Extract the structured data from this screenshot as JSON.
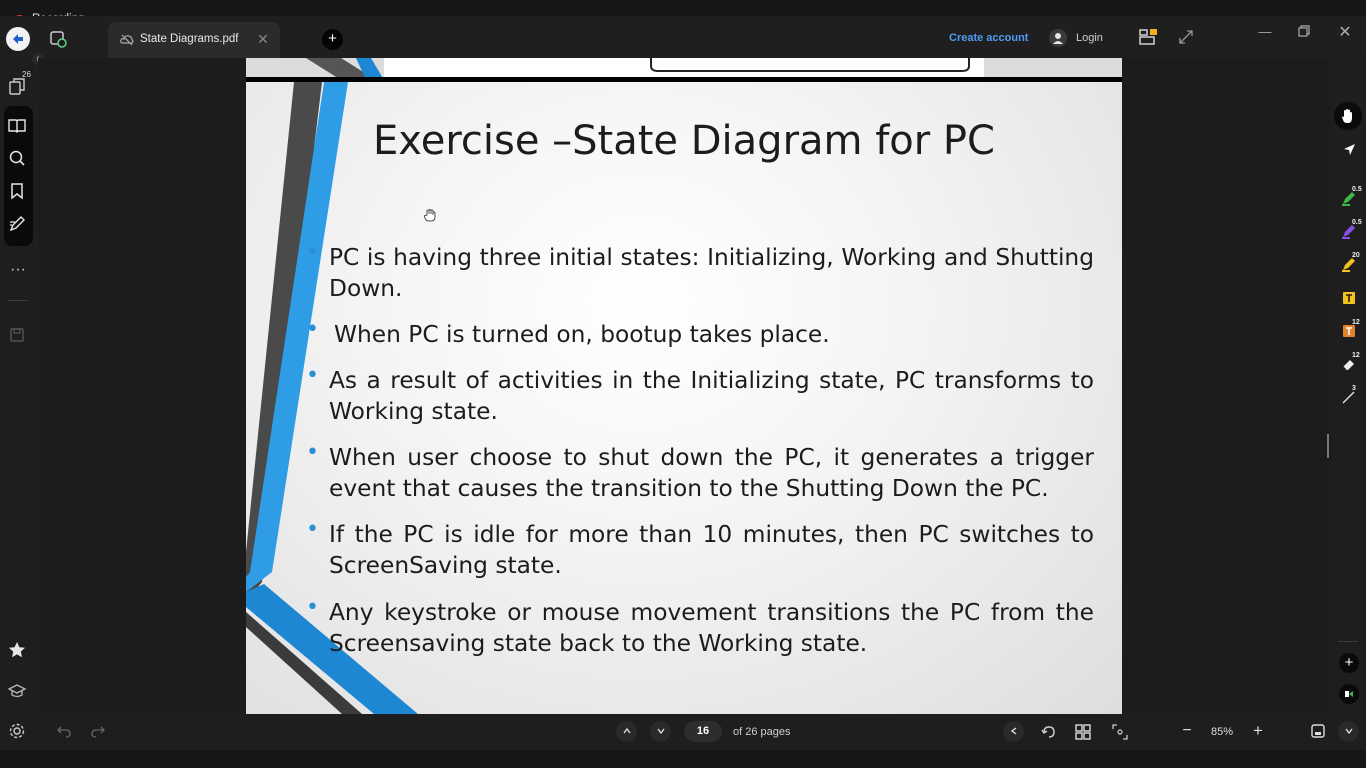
{
  "recording": {
    "label": "Recording"
  },
  "tab": {
    "title": "State Diagrams.pdf"
  },
  "header": {
    "create_account": "Create account",
    "login": "Login"
  },
  "left_rail": {
    "pages_badge": "26"
  },
  "slide": {
    "title": "Exercise –State Diagram for PC",
    "bullets": [
      "PC is having three initial states: Initializing, Working and Shutting Down.",
      "When PC is turned on, bootup takes place.",
      "As a result of activities in the Initializing state, PC transforms to Working state.",
      "When user choose to shut down the PC, it generates a trigger event that causes the transition to the Shutting Down the PC.",
      "If the PC is idle for more than 10 minutes, then PC switches to ScreenSaving state.",
      "Any keystroke or mouse movement transitions the PC from the Screensaving state back to the Working state."
    ]
  },
  "right_rail": {
    "badges": {
      "highlighter": "0.5",
      "pen": "0.5",
      "marker": "20",
      "text": "12",
      "eraser": "12",
      "line": "3"
    }
  },
  "navigation": {
    "current_page": "16",
    "total_label": "of 26 pages",
    "zoom": "85%"
  },
  "colors": {
    "accent_blue": "#2b8fd6",
    "link_blue": "#4e9bf5",
    "record_red": "#e23a3a"
  },
  "icons": [
    "app-logo-icon",
    "side-panel-icon",
    "pages-icon",
    "book-icon",
    "search-icon",
    "bookmark-icon",
    "annotate-icon",
    "more-icon",
    "save-icon",
    "star-icon",
    "education-icon",
    "settings-icon",
    "undo-icon",
    "redo-icon",
    "hand-icon",
    "select-icon",
    "highlighter-icon",
    "pen-icon",
    "marker-icon",
    "text-icon",
    "eraser-icon",
    "line-icon",
    "add-icon",
    "chevron-up-icon",
    "chevron-down-icon",
    "rotate-icon",
    "grid-icon",
    "fit-icon",
    "zoom-out-icon",
    "zoom-in-icon"
  ]
}
